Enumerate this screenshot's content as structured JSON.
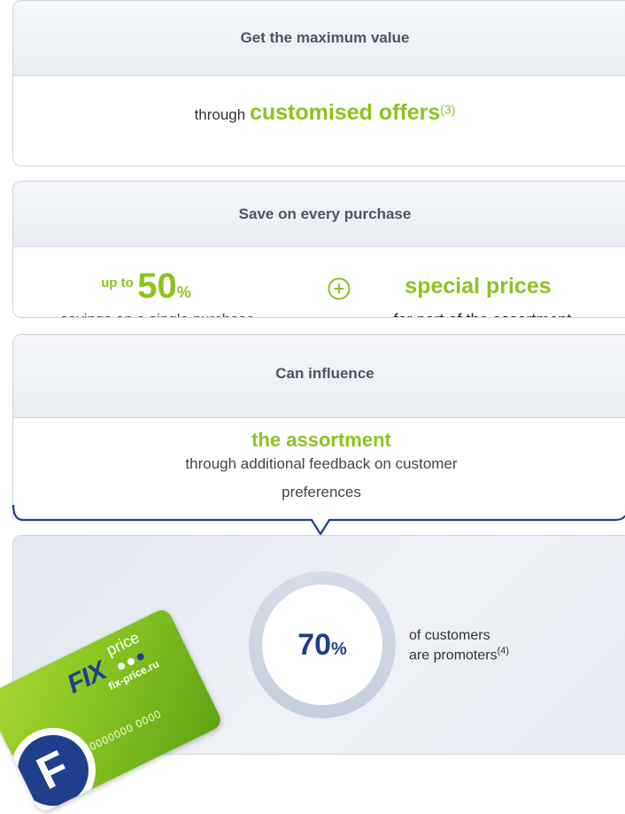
{
  "section1": {
    "header": "Get the maximum value",
    "prefix": "through",
    "highlight": "customised offers",
    "footnote": "(3)"
  },
  "section2": {
    "header": "Save on every purchase",
    "up_to": "up to",
    "value": "50",
    "percent": "%",
    "savings_text": "savings on a single purchase",
    "highlight": "special prices",
    "assortment_text": "for part of the assortment"
  },
  "section3": {
    "header": "Can influence",
    "highlight": "the assortment",
    "line1": "through additional feedback on customer",
    "line2": "preferences"
  },
  "section4": {
    "value": "70",
    "percent": "%",
    "line1": "of customers",
    "line2": "are promoters",
    "footnote": "(4)",
    "card": {
      "brand_fix": "FIX",
      "brand_price": "price",
      "website": "fix-price.ru",
      "number": "0000000000 0000",
      "logo_letter": "F"
    }
  },
  "colors": {
    "accent_green": "#8dc21f",
    "navy": "#1f3f8c",
    "header_text": "#4b5563"
  }
}
